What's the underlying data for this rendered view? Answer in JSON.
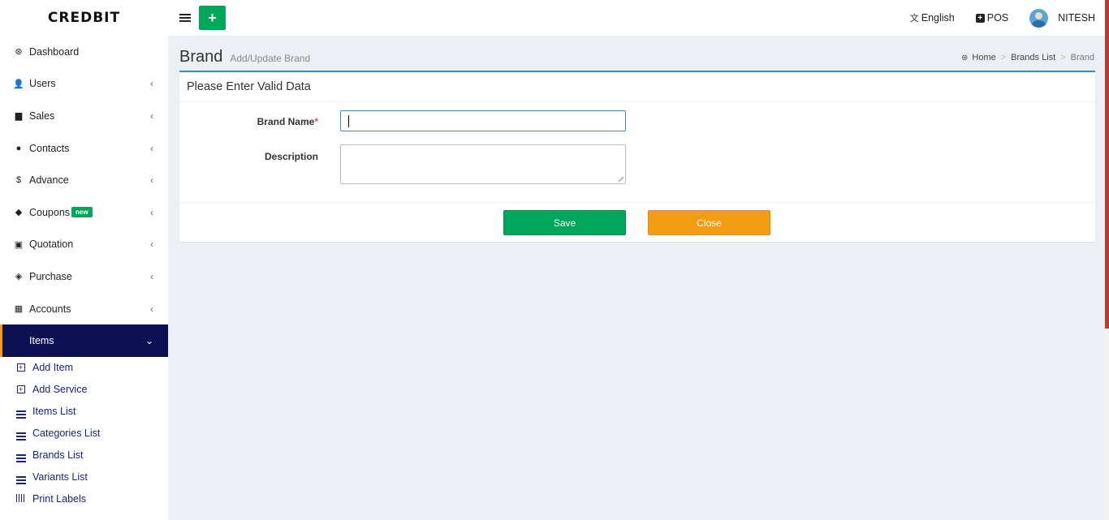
{
  "header": {
    "logo": "CREDBIT",
    "add_button": "+",
    "language": "English",
    "pos": "POS",
    "user": "NITESH"
  },
  "sidebar": {
    "items": [
      {
        "label": "Dashboard",
        "icon": "dashboard-icon",
        "glyph": "⊛",
        "has_chevron": false
      },
      {
        "label": "Users",
        "icon": "user-plus-icon",
        "glyph": "👤",
        "has_chevron": true
      },
      {
        "label": "Sales",
        "icon": "cart-icon",
        "glyph": "▆",
        "has_chevron": true
      },
      {
        "label": "Contacts",
        "icon": "users-icon",
        "glyph": "●",
        "has_chevron": true
      },
      {
        "label": "Advance",
        "icon": "dollar-icon",
        "glyph": "$",
        "has_chevron": true
      },
      {
        "label": "Coupons",
        "icon": "tags-icon",
        "glyph": "◆",
        "has_chevron": true,
        "badge": "new"
      },
      {
        "label": "Quotation",
        "icon": "calendar-plus-icon",
        "glyph": "▣",
        "has_chevron": true
      },
      {
        "label": "Purchase",
        "icon": "cube-icon",
        "glyph": "◈",
        "has_chevron": true
      },
      {
        "label": "Accounts",
        "icon": "grid-icon",
        "glyph": "▦",
        "has_chevron": true
      }
    ],
    "active_item": {
      "label": "Items",
      "chevron": "⌄"
    },
    "sub_items": [
      {
        "label": "Add Item",
        "icon": "plus-square-icon"
      },
      {
        "label": "Add Service",
        "icon": "plus-square-icon"
      },
      {
        "label": "Items List",
        "icon": "list-icon"
      },
      {
        "label": "Categories List",
        "icon": "list-icon"
      },
      {
        "label": "Brands List",
        "icon": "list-icon"
      },
      {
        "label": "Variants List",
        "icon": "list-icon"
      },
      {
        "label": "Print Labels",
        "icon": "barcode-icon"
      }
    ]
  },
  "page": {
    "title": "Brand",
    "subtitle": "Add/Update Brand"
  },
  "breadcrumb": {
    "home": "Home",
    "list": "Brands List",
    "current": "Brand"
  },
  "form": {
    "header": "Please Enter Valid Data",
    "brand_name_label": "Brand Name",
    "required_mark": "*",
    "brand_name_value": "",
    "description_label": "Description",
    "description_value": "",
    "save_label": "Save",
    "close_label": "Close"
  },
  "colors": {
    "sidebar_active": "#0b1151",
    "accent_green": "#00a65a",
    "accent_orange": "#f39c12",
    "box_border": "#3c8dbc"
  }
}
